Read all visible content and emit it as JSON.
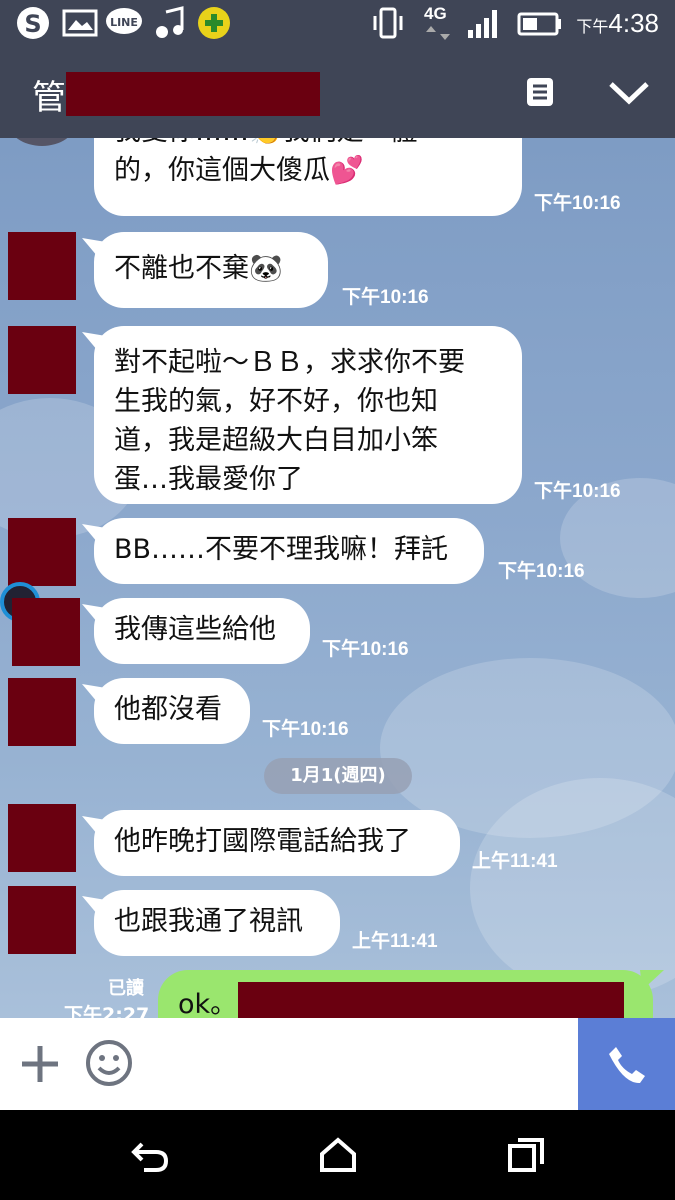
{
  "status_bar": {
    "network": "4G",
    "time_prefix": "下午",
    "time": "4:38",
    "app_icons": [
      "skype-icon",
      "image-icon",
      "line-icon",
      "music-icon",
      "game-icon"
    ]
  },
  "header": {
    "title": "管"
  },
  "messages": [
    {
      "text": "我愛你……👏我們是一體\n的，你這個大傻瓜💕",
      "time": "下午10:16"
    },
    {
      "text": "不離也不棄🐼",
      "time": "下午10:16"
    },
    {
      "text": "對不起啦～ＢＢ，求求你不要\n生我的氣，好不好，你也知\n道，我是超級大白目加小笨\n蛋…我最愛你了",
      "time": "下午10:16"
    },
    {
      "text": "BB……不要不理我嘛！拜託",
      "time": "下午10:16"
    },
    {
      "text": "我傳這些給他",
      "time": "下午10:16"
    },
    {
      "text": "他都沒看",
      "time": "下午10:16"
    },
    {
      "text": "他昨晚打國際電話給我了",
      "time": "上午11:41"
    },
    {
      "text": "也跟我通了視訊",
      "time": "上午11:41"
    }
  ],
  "date_separator": "1月1(週四)",
  "outgoing": {
    "read_label": "已讀",
    "time": "下午2:27",
    "text": "ok。"
  },
  "colors": {
    "header_bg": "#3f4556",
    "outgoing_bubble": "#9ae66e",
    "call_button": "#5b7ed6"
  }
}
